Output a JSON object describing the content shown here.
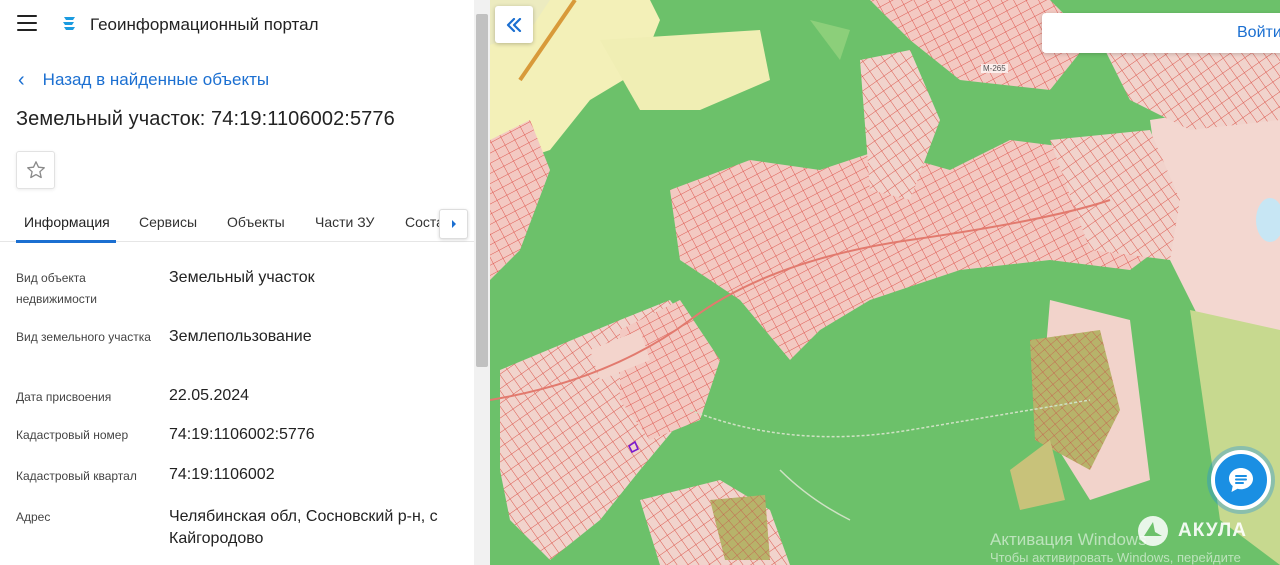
{
  "header": {
    "app_title": "Геоинформационный портал",
    "menu_icon": "hamburger-icon",
    "logo_icon": "portal-logo-icon"
  },
  "back_link": {
    "label": "Назад в найденные объекты"
  },
  "object": {
    "title": "Земельный участок: 74:19:1106002:5776"
  },
  "tabs": [
    {
      "label": "Информация",
      "active": true
    },
    {
      "label": "Сервисы"
    },
    {
      "label": "Объекты"
    },
    {
      "label": "Части ЗУ"
    },
    {
      "label": "Соста"
    }
  ],
  "fields": [
    {
      "label": "Вид объекта недвижимости",
      "value": "Земельный участок"
    },
    {
      "label": "Вид земельного участка",
      "value": "Землепользование"
    },
    {
      "label": "Дата присвоения",
      "value": "22.05.2024"
    },
    {
      "label": "Кадастровый номер",
      "value": "74:19:1106002:5776"
    },
    {
      "label": "Кадастровый квартал",
      "value": "74:19:1106002"
    },
    {
      "label": "Адрес",
      "value": "Челябинская обл, Сосновский р-н, с Кайгородово"
    }
  ],
  "map": {
    "search_button": "Войти",
    "road_label": "М-265",
    "watermark_line1": "Активация Windows",
    "watermark_line2": "Чтобы активировать Windows, перейдите",
    "brand": "АКУЛА"
  },
  "colors": {
    "accent": "#1b6fd1",
    "parcel_line": "#e0534f",
    "forest": "#6cc16a",
    "field": "#f1efb0"
  }
}
